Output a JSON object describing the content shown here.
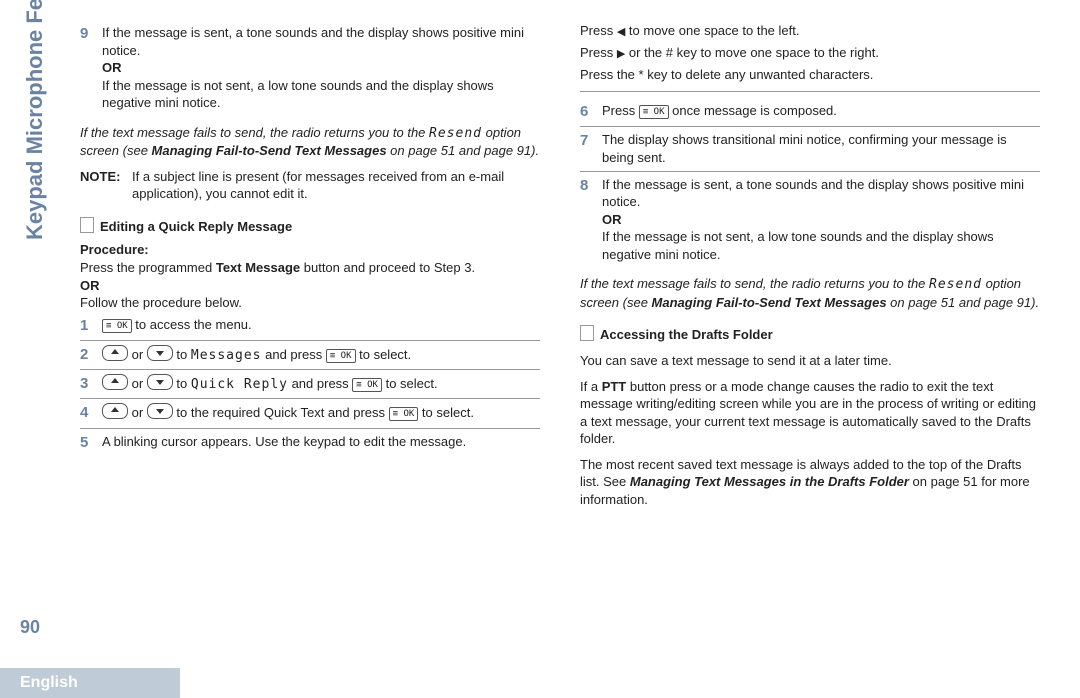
{
  "sidebar": {
    "label": "Keypad Microphone Features"
  },
  "page_number": "90",
  "footer_language": "English",
  "left": {
    "step9_num": "9",
    "step9_a": "If the message is sent, a tone sounds and the display shows positive mini notice.",
    "or": "OR",
    "step9_b": "If the message is not sent, a low tone sounds and the display shows negative mini notice.",
    "fail_a": "If the text message fails to send, the radio returns you to the ",
    "fail_resend": "Resend",
    "fail_b": " option screen (see ",
    "fail_bold": "Managing Fail-to-Send Text Messages",
    "fail_c": " on page 51 and page 91).",
    "note_label": "NOTE:",
    "note_text": "If a subject line is present (for messages received from an e-mail application), you cannot edit it.",
    "section_title": "Editing a Quick Reply Message",
    "procedure": "Procedure:",
    "proc_a": "Press the programmed ",
    "proc_bold": "Text Message",
    "proc_b": " button and proceed to Step 3.",
    "proc_c": "Follow the procedure below.",
    "s1_num": "1",
    "s1_text": " to access the menu.",
    "s2_num": "2",
    "s2_a": " or ",
    "s2_b": " to ",
    "s2_target": "Messages",
    "s2_c": " and press ",
    "s2_d": " to select.",
    "s3_num": "3",
    "s3_target": "Quick Reply",
    "s4_num": "4",
    "s4_b": " to the required Quick Text and press ",
    "s4_d": " to select.",
    "s5_num": "5",
    "s5_text": "A blinking cursor appears. Use the keypad to edit the message."
  },
  "right": {
    "r1": "Press ",
    "r1b": " to move one space to the left.",
    "r2": "Press ",
    "r2b": " or the # key to move one space to the right.",
    "r3": "Press the * key to delete any unwanted characters.",
    "s6_num": "6",
    "s6_a": "Press ",
    "s6_b": " once message is composed.",
    "s7_num": "7",
    "s7_text": "The display shows transitional mini notice, confirming your message is being sent.",
    "s8_num": "8",
    "s8_a": "If the message is sent, a tone sounds and the display shows positive mini notice.",
    "s8_b": "If the message is not sent, a low tone sounds and the display shows negative mini notice.",
    "fail_a": "If the text message fails to send, the radio returns you to the ",
    "fail_resend": "Resend",
    "fail_b": " option screen (see ",
    "fail_bold": "Managing Fail-to-Send Text Messages",
    "fail_c": " on page 51 and page 91).",
    "section_title": "Accessing the Drafts Folder",
    "d1": "You can save a text message to send it at a later time.",
    "d2a": "If a ",
    "d2bold": "PTT",
    "d2b": " button press or a mode change causes the radio to exit the text message writing/editing screen while you are in the process of writing or editing a text message, your current text message is automatically saved to the Drafts folder.",
    "d3a": "The most recent saved text message is always added to the top of the Drafts list. See ",
    "d3bold": "Managing Text Messages in the Drafts Folder",
    "d3b": " on page 51 for more information."
  },
  "keys": {
    "ok": "≡ OK"
  }
}
